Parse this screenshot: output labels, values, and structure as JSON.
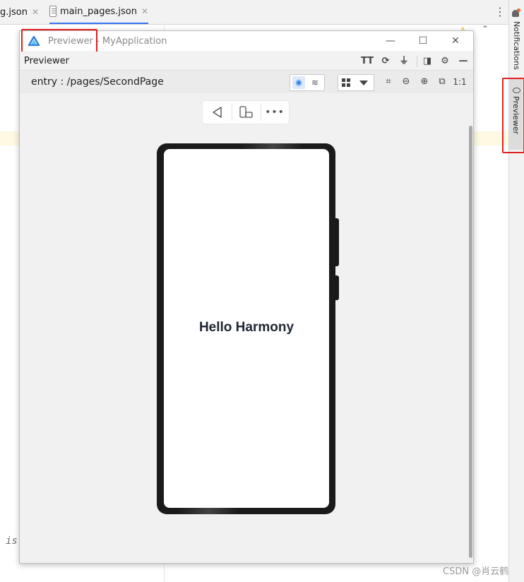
{
  "ide": {
    "tabs": [
      {
        "label": "g.json",
        "close": "✕"
      },
      {
        "label": "main_pages.json",
        "close": "✕"
      }
    ],
    "more_icon": "kebab-icon",
    "editor_fragment": "is",
    "right_strip": {
      "notifications_label": "Notifications",
      "previewer_label": "Previewer"
    }
  },
  "window": {
    "title_app": "Previewer",
    "title_sep": " - ",
    "title_project": "MyApplication",
    "controls": {
      "minimize": "—",
      "maximize": "☐",
      "close": "✕"
    }
  },
  "previewer": {
    "header_title": "Previewer",
    "toolbar_icons": [
      "font-size-icon",
      "refresh-icon",
      "plug-icon",
      "panel-icon",
      "settings-icon",
      "minimize-icon"
    ],
    "toolbar_glyphs": {
      "font": "TT",
      "refresh": "⟳",
      "plug": "⏚",
      "panel": "◨",
      "settings": "⚙",
      "hide": "—"
    },
    "path": "entry : /pages/SecondPage",
    "zoom_glyphs": {
      "fit": "⌗",
      "zoom_out": "⊖",
      "zoom_in": "⊕",
      "actual": "⧉",
      "ratio": "1:1"
    },
    "nav": {
      "back": "◁",
      "rotate": "rotate-device-icon",
      "more": "•••"
    },
    "device_text": "Hello Harmony"
  },
  "watermark": "CSDN @肖云鹤",
  "colors": {
    "annotation_red": "#e02020",
    "accent_blue": "#2d7be5",
    "phone_frame": "#1a1a1a"
  }
}
